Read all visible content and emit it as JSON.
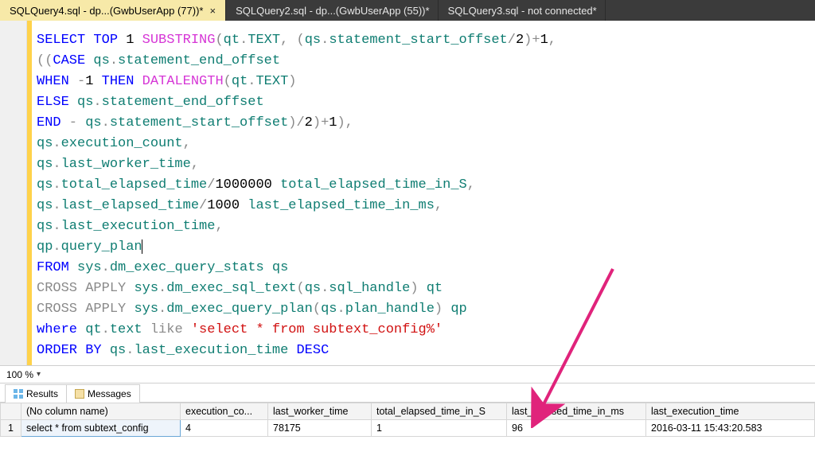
{
  "tabs": [
    {
      "label": "SQLQuery4.sql - dp...(GwbUserApp (77))*",
      "active": true,
      "closable": true
    },
    {
      "label": "SQLQuery2.sql - dp...(GwbUserApp (55))*",
      "active": false,
      "closable": false
    },
    {
      "label": "SQLQuery3.sql - not connected*",
      "active": false,
      "closable": false
    }
  ],
  "sql": {
    "l1": {
      "a": "SELECT",
      "b": " TOP ",
      "c": "1 ",
      "d": "SUBSTRING",
      "e": "(",
      "f": "qt",
      "g": ".",
      "h": "TEXT",
      "i": ", (",
      "j": "qs",
      "k": ".",
      "l": "statement_start_offset",
      "m": "/",
      "n": "2",
      "o": ")+",
      "p": "1",
      "q": ","
    },
    "l2": {
      "a": "((",
      "b": "CASE",
      "c": " ",
      "d": "qs",
      "e": ".",
      "f": "statement_end_offset"
    },
    "l3": {
      "a": "WHEN",
      "b": " -",
      "c": "1 ",
      "d": "THEN",
      "e": " ",
      "f": "DATALENGTH",
      "g": "(",
      "h": "qt",
      "i": ".",
      "j": "TEXT",
      "k": ")"
    },
    "l4": {
      "a": "ELSE",
      "b": " ",
      "c": "qs",
      "d": ".",
      "e": "statement_end_offset"
    },
    "l5": {
      "a": "END",
      "b": " - ",
      "c": "qs",
      "d": ".",
      "e": "statement_start_offset",
      "f": ")/",
      "g": "2",
      "h": ")+",
      "i": "1",
      "j": "),"
    },
    "l6": {
      "a": "qs",
      "b": ".",
      "c": "execution_count",
      "d": ","
    },
    "l7": {
      "a": "qs",
      "b": ".",
      "c": "last_worker_time",
      "d": ","
    },
    "l8": {
      "a": "qs",
      "b": ".",
      "c": "total_elapsed_time",
      "d": "/",
      "e": "1000000 ",
      "f": "total_elapsed_time_in_S",
      "g": ","
    },
    "l9": {
      "a": "qs",
      "b": ".",
      "c": "last_elapsed_time",
      "d": "/",
      "e": "1000 ",
      "f": "last_elapsed_time_in_ms",
      "g": ","
    },
    "l10": {
      "a": "qs",
      "b": ".",
      "c": "last_execution_time",
      "d": ","
    },
    "l11": {
      "a": "qp",
      "b": ".",
      "c": "query_plan"
    },
    "l12": {
      "a": "FROM",
      "b": " ",
      "c": "sys",
      "d": ".",
      "e": "dm_exec_query_stats",
      "f": " ",
      "g": "qs"
    },
    "l13": {
      "a": "CROSS",
      "b": " ",
      "c": "APPLY",
      "d": " ",
      "e": "sys",
      "f": ".",
      "g": "dm_exec_sql_text",
      "h": "(",
      "i": "qs",
      "j": ".",
      "k": "sql_handle",
      "l": ") ",
      "m": "qt"
    },
    "l14": {
      "a": "CROSS",
      "b": " ",
      "c": "APPLY",
      "d": " ",
      "e": "sys",
      "f": ".",
      "g": "dm_exec_query_plan",
      "h": "(",
      "i": "qs",
      "j": ".",
      "k": "plan_handle",
      "l": ") ",
      "m": "qp"
    },
    "l15": {
      "a": "where",
      "b": " ",
      "c": "qt",
      "d": ".",
      "e": "text",
      "f": " ",
      "g": "like",
      "h": " ",
      "i": "'select * from subtext_config%'"
    },
    "l16": {
      "a": "ORDER",
      "b": " ",
      "c": "BY",
      "d": " ",
      "e": "qs",
      "f": ".",
      "g": "last_execution_time",
      "h": " ",
      "i": "DESC"
    }
  },
  "zoom": "100 %",
  "resultTabs": {
    "results": "Results",
    "messages": "Messages"
  },
  "grid": {
    "headers": [
      "",
      "(No column name)",
      "execution_co...",
      "last_worker_time",
      "total_elapsed_time_in_S",
      "last_elapsed_time_in_ms",
      "last_execution_time"
    ],
    "rows": [
      {
        "num": "1",
        "cells": [
          "select * from subtext_config",
          "4",
          "78175",
          "1",
          "96",
          "2016-03-11 15:43:20.583"
        ]
      }
    ]
  }
}
